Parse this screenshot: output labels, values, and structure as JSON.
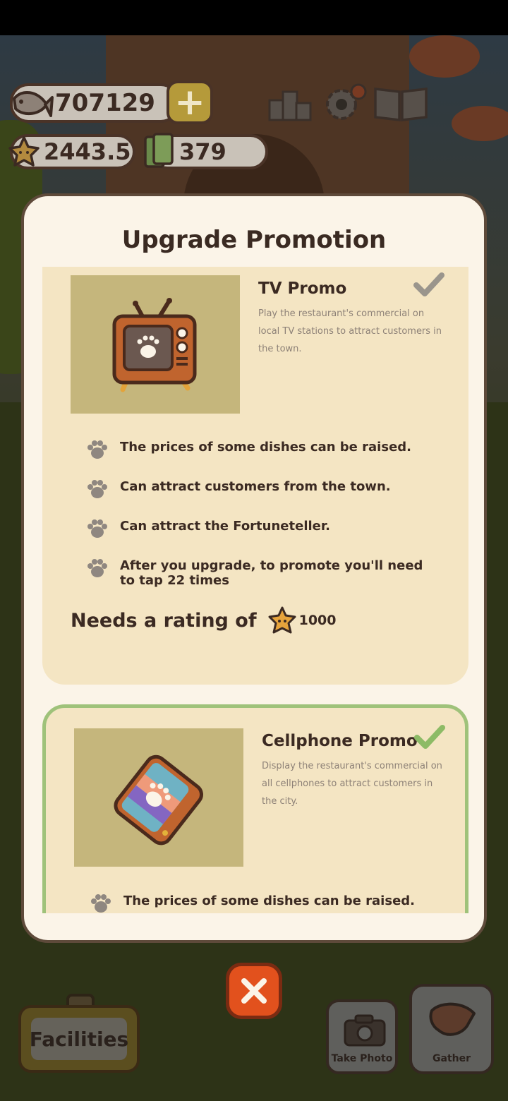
{
  "hud": {
    "fish_currency": "707129",
    "rating": "2443.5",
    "cash": "379",
    "plus_label": "+"
  },
  "modal": {
    "title": "Upgrade Promotion",
    "close_label": "✕",
    "promos": [
      {
        "name": "TV Promo",
        "description": "Play the restaurant's commercial on local TV stations to attract customers in the town.",
        "status": "completed",
        "check_color": "#9a958c",
        "perks": [
          "The prices of some dishes can be raised.",
          "Can attract customers from the town.",
          "Can attract the Fortuneteller.",
          "After you upgrade, to promote you'll need to tap  22  times"
        ],
        "requirement_label": "Needs a rating of",
        "requirement_value": "1000"
      },
      {
        "name": "Cellphone Promo",
        "description": "Display the restaurant's commercial on all cellphones to attract customers in the city.",
        "status": "available",
        "check_color": "#8dbb66",
        "perks": [
          "The prices of some dishes can be raised."
        ]
      }
    ]
  },
  "bottom_bar": {
    "facilities_label": "Facilities",
    "take_photo_label": "Take Photo",
    "gather_label": "Gather"
  },
  "colors": {
    "modal_bg": "#fbf4e8",
    "card_bg": "#f4e5c3",
    "thumb_bg": "#c5b67c",
    "close_button": "#e2511d",
    "selected_border": "#9fc27a"
  }
}
